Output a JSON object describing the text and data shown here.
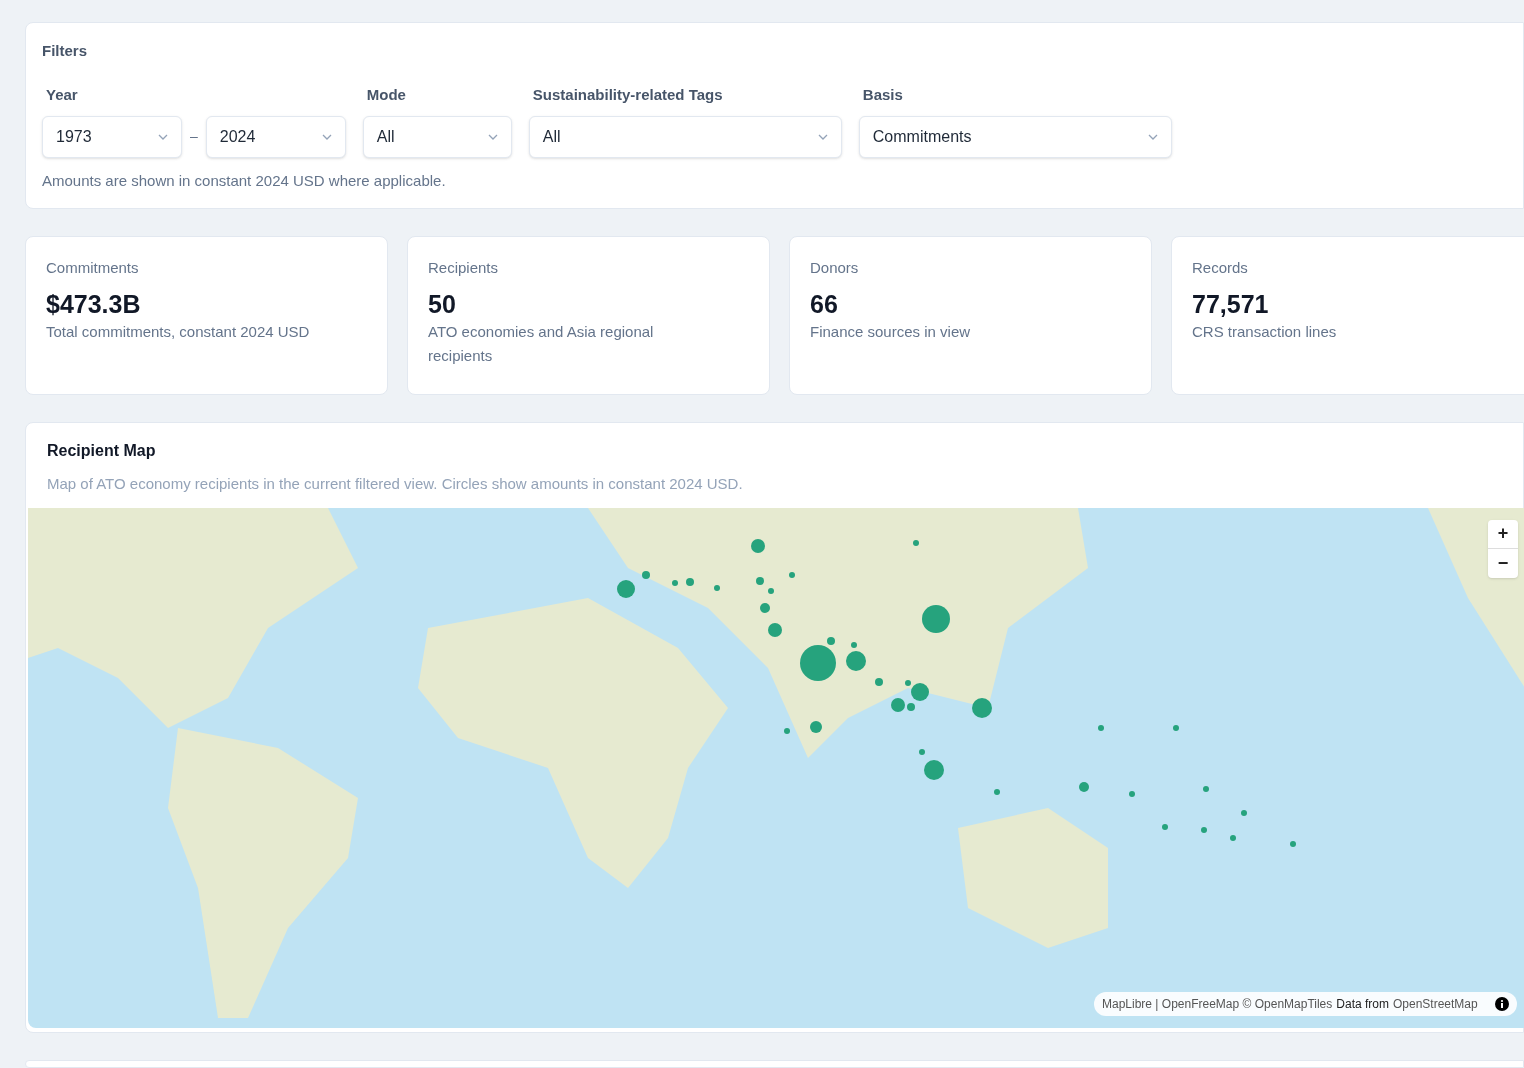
{
  "filters": {
    "title": "Filters",
    "groups": [
      {
        "label": "Year",
        "selects": [
          {
            "value": "1973"
          },
          {
            "value": "2024"
          }
        ],
        "separator": "–"
      },
      {
        "label": "Mode",
        "selects": [
          {
            "value": "All"
          }
        ]
      },
      {
        "label": "Sustainability-related Tags",
        "selects": [
          {
            "value": "All"
          }
        ]
      },
      {
        "label": "Basis",
        "selects": [
          {
            "value": "Commitments"
          }
        ]
      }
    ],
    "note": "Amounts are shown in constant 2024 USD where applicable."
  },
  "stats": [
    {
      "label": "Commitments",
      "value": "$473.3B",
      "caption": "Total commitments, constant 2024 USD"
    },
    {
      "label": "Recipients",
      "value": "50",
      "caption": "ATO economies and Asia regional recipients"
    },
    {
      "label": "Donors",
      "value": "66",
      "caption": "Finance sources in view"
    },
    {
      "label": "Records",
      "value": "77,571",
      "caption": "CRS transaction lines"
    }
  ],
  "map": {
    "title": "Recipient Map",
    "subtitle": "Map of ATO economy recipients in the current filtered view. Circles show amounts in constant 2024 USD.",
    "zoom_in": "+",
    "zoom_out": "−",
    "attribution": [
      {
        "text": "MapLibre | OpenFreeMap © OpenMapTiles",
        "kind": "link"
      },
      {
        "text": "Data from",
        "kind": "plain"
      },
      {
        "text": "OpenStreetMap",
        "kind": "link"
      }
    ]
  }
}
